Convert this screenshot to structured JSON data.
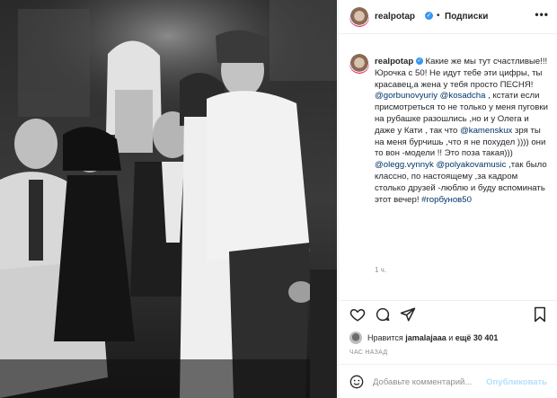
{
  "header": {
    "username": "realpotap",
    "separator": "•",
    "follow_label": "Подписки",
    "more_label": "•••"
  },
  "caption": {
    "username": "realpotap",
    "text_1": " Какие же мы тут счастливые!!! Юрочка с 50! Не идут тебе эти цифры, ты красавец,а жена у тебя просто ПЕСНЯ! ",
    "mention_1": "@gorbunovyuriy",
    "mention_2": "@kosadcha",
    "text_2": " , кстати если присмотреться то не только у меня пуговки на рубашке разошлись ,но и у Олега и даже у Кати , так что ",
    "mention_3": "@kamenskux",
    "text_3": " зря ты на меня бурчишь ,что я не похудел )))) они то вон -модели !! Это поза такая))) ",
    "mention_4": "@olegg.vynnyk",
    "text_4": " ",
    "mention_5": "@polyakovamusic",
    "text_5": " ,так было классно, по настоящему ,за кадром столько друзей -люблю и буду вспоминать этот вечер! ",
    "hashtag": "#горбунов50",
    "time_ago": "1 ч."
  },
  "likes": {
    "prefix": "Нравится ",
    "user": "jamalajaaa",
    "middle": " и ",
    "count": "ещё 30 401"
  },
  "posted": "ЧАС НАЗАД",
  "comment": {
    "placeholder": "Добавьте комментарий...",
    "publish_label": "Опубликовать"
  },
  "icons": {
    "like": "heart-icon",
    "comment": "comment-icon",
    "share": "share-icon",
    "save": "bookmark-icon",
    "emoji": "smiley-icon"
  },
  "colors": {
    "link": "#003569",
    "verified": "#3897f0",
    "muted": "#8e8e8e",
    "publish_disabled": "#b2dffc"
  }
}
